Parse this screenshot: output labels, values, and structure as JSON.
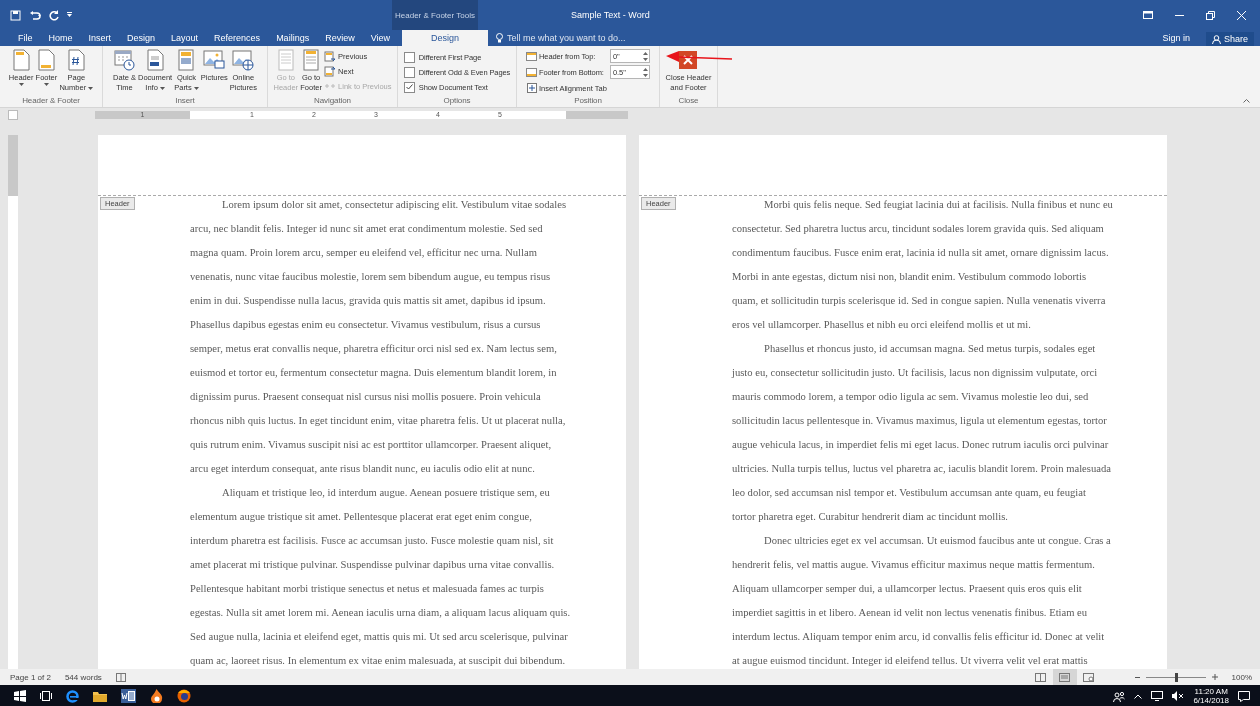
{
  "title_bar": {
    "contextual_group": "Header & Footer Tools",
    "title": "Sample Text - Word"
  },
  "tabs": [
    {
      "label": "File",
      "selected": false
    },
    {
      "label": "Home",
      "selected": false
    },
    {
      "label": "Insert",
      "selected": false
    },
    {
      "label": "Design",
      "selected": false
    },
    {
      "label": "Layout",
      "selected": false
    },
    {
      "label": "References",
      "selected": false
    },
    {
      "label": "Mailings",
      "selected": false
    },
    {
      "label": "Review",
      "selected": false
    },
    {
      "label": "View",
      "selected": false
    },
    {
      "label": "Design",
      "selected": true
    }
  ],
  "tell_me": {
    "placeholder": "Tell me what you want to do..."
  },
  "account": {
    "sign_in": "Sign in",
    "share": "Share"
  },
  "ribbon_groups": [
    {
      "label": "Header & Footer",
      "items": [
        {
          "kind": "large",
          "lines": [
            "Header"
          ],
          "dropdown": true,
          "disabled": false
        },
        {
          "kind": "large",
          "lines": [
            "Footer"
          ],
          "dropdown": true,
          "disabled": false
        },
        {
          "kind": "large",
          "lines": [
            "Page",
            "Number"
          ],
          "dropdown": true,
          "disabled": false
        }
      ]
    },
    {
      "label": "Insert",
      "items": [
        {
          "kind": "large",
          "lines": [
            "Date &",
            "Time"
          ],
          "dropdown": false,
          "disabled": false
        },
        {
          "kind": "large",
          "lines": [
            "Document",
            "Info"
          ],
          "dropdown": true,
          "disabled": false
        },
        {
          "kind": "large",
          "lines": [
            "Quick",
            "Parts"
          ],
          "dropdown": true,
          "disabled": false
        },
        {
          "kind": "large",
          "lines": [
            "Pictures"
          ],
          "dropdown": false,
          "disabled": false
        },
        {
          "kind": "large",
          "lines": [
            "Online",
            "Pictures"
          ],
          "dropdown": false,
          "disabled": false
        }
      ]
    },
    {
      "label": "Navigation",
      "items": [
        {
          "kind": "large",
          "lines": [
            "Go to",
            "Header"
          ],
          "dropdown": false,
          "disabled": true
        },
        {
          "kind": "large",
          "lines": [
            "Go to",
            "Footer"
          ],
          "dropdown": false,
          "disabled": false
        },
        {
          "kind": "stack",
          "items": [
            {
              "label": "Previous",
              "disabled": false
            },
            {
              "label": "Next",
              "disabled": false
            },
            {
              "label": "Link to Previous",
              "disabled": true
            }
          ]
        }
      ]
    },
    {
      "label": "Options",
      "items": [
        {
          "kind": "checks",
          "items": [
            {
              "label": "Different First Page",
              "checked": false
            },
            {
              "label": "Different Odd & Even Pages",
              "checked": false
            },
            {
              "label": "Show Document Text",
              "checked": true
            }
          ]
        }
      ]
    },
    {
      "label": "Position",
      "items": [
        {
          "kind": "position",
          "fields": [
            {
              "label": "Header from Top:",
              "value": "0\""
            },
            {
              "label": "Footer from Bottom:",
              "value": "0.5\""
            }
          ],
          "button": "Insert Alignment Tab"
        }
      ]
    },
    {
      "label": "Close",
      "items": [
        {
          "kind": "large",
          "lines": [
            "Close Header",
            "and Footer"
          ],
          "dropdown": false,
          "disabled": false
        }
      ]
    }
  ],
  "ruler": {
    "numbers": [
      "1",
      "1",
      "2",
      "3",
      "4",
      "5"
    ]
  },
  "pages": [
    {
      "header_tag": "Header",
      "paragraphs": [
        {
          "lines": [
            "Lorem ipsum dolor sit amet, consectetur adipiscing elit. Vestibulum vitae sodales",
            "arcu, nec blandit felis. Integer id nunc sit amet erat condimentum molestie. Sed sed",
            "magna quam. Proin lorem arcu, semper eu eleifend vel, efficitur nec urna. Nullam",
            "venenatis, nunc vitae faucibus molestie, lorem sem bibendum augue, eu tempus risus",
            "enim in dui. Suspendisse nulla lacus, gravida quis mattis sit amet, dapibus id ipsum.",
            "Phasellus dapibus egestas enim eu consectetur. Vivamus vestibulum, risus a cursus",
            "semper, metus erat convallis neque, pharetra efficitur orci nisl sed ex. Nam lectus sem,",
            "euismod et tortor eu, fermentum consectetur magna. Duis elementum blandit lorem, in",
            "dignissim purus. Praesent consequat nisl cursus nisi mollis posuere. Proin vehicula",
            "rhoncus nibh quis luctus. In eget tincidunt enim, vitae pharetra felis. Ut ut placerat nulla,",
            "quis rutrum enim. Vivamus suscipit nisi ac est porttitor ullamcorper. Praesent aliquet,",
            "arcu eget interdum consequat, ante risus blandit nunc, eu iaculis odio elit at nunc."
          ]
        },
        {
          "lines": [
            "Aliquam et tristique leo, id interdum augue. Aenean posuere tristique sem, eu",
            "elementum augue tristique sit amet. Pellentesque placerat erat eget enim congue,",
            "interdum pharetra est facilisis. Fusce ac accumsan justo. Fusce molestie quam nisl, sit",
            "amet placerat mi tristique pulvinar. Suspendisse pulvinar dapibus urna vitae convallis.",
            "Pellentesque habitant morbi tristique senectus et netus et malesuada fames ac turpis",
            "egestas. Nulla sit amet lorem mi. Aenean iaculis urna diam, a aliquam lacus aliquam quis.",
            "Sed augue nulla, lacinia et eleifend eget, mattis quis mi. Ut sed arcu scelerisque, pulvinar",
            "quam ac, laoreet risus. In elementum ex vitae enim malesuada, at suscipit dui bibendum."
          ]
        }
      ]
    },
    {
      "header_tag": "Header",
      "paragraphs": [
        {
          "lines": [
            "Morbi quis felis neque. Sed feugiat lacinia dui at facilisis. Nulla finibus et nunc eu",
            "consectetur. Sed pharetra luctus arcu, tincidunt sodales lorem gravida quis. Sed aliquam",
            "condimentum faucibus. Fusce enim erat, lacinia id nulla sit amet, ornare dignissim lacus.",
            "Morbi in ante egestas, dictum nisi non, blandit enim. Vestibulum commodo lobortis",
            "quam, et sollicitudin turpis scelerisque id. Sed in congue sapien. Nulla venenatis viverra",
            "eros vel ullamcorper. Phasellus et nibh eu orci eleifend mollis et ut mi."
          ]
        },
        {
          "lines": [
            "Phasellus et rhoncus justo, id accumsan magna. Sed metus turpis, sodales eget",
            "justo eu, consectetur sollicitudin justo. Ut facilisis, lacus non dignissim vulputate, orci",
            "mauris commodo lorem, a tempor odio ligula ac sem. Vivamus molestie leo dui, sed",
            "sollicitudin lacus pellentesque in. Vivamus maximus, ligula ut elementum egestas, tortor",
            "augue vehicula lacus, in imperdiet felis mi eget lacus. Donec rutrum iaculis orci pulvinar",
            "ultricies. Nulla turpis tellus, luctus vel pharetra ac, iaculis blandit lorem. Proin malesuada",
            "leo dolor, sed accumsan nisl tempor et. Vestibulum accumsan ante quam, eu feugiat",
            "tortor pharetra eget. Curabitur hendrerit diam ac tincidunt mollis."
          ]
        },
        {
          "lines": [
            "Donec ultricies eget ex vel accumsan. Ut euismod faucibus ante ut congue. Cras a",
            "hendrerit felis, vel mattis augue. Vivamus efficitur maximus neque mattis fermentum.",
            "Aliquam ullamcorper semper dui, a ullamcorper lectus. Praesent quis eros quis elit",
            "imperdiet sagittis in et libero. Aenean id velit non lectus venenatis finibus. Etiam eu",
            "interdum lectus. Aliquam tempor enim arcu, id convallis felis efficitur id. Donec at velit",
            "at augue euismod tincidunt. Integer id eleifend tellus. Ut viverra velit vel erat mattis"
          ]
        }
      ]
    }
  ],
  "status_bar": {
    "page": "Page 1 of 2",
    "words": "544 words",
    "views": [
      {
        "selected": false
      },
      {
        "selected": true
      },
      {
        "selected": false
      }
    ],
    "zoom": {
      "level": 0.5
    },
    "zoom_label": "100%"
  },
  "taskbar": {
    "time": "11:20 AM",
    "date": "6/14/2018"
  }
}
